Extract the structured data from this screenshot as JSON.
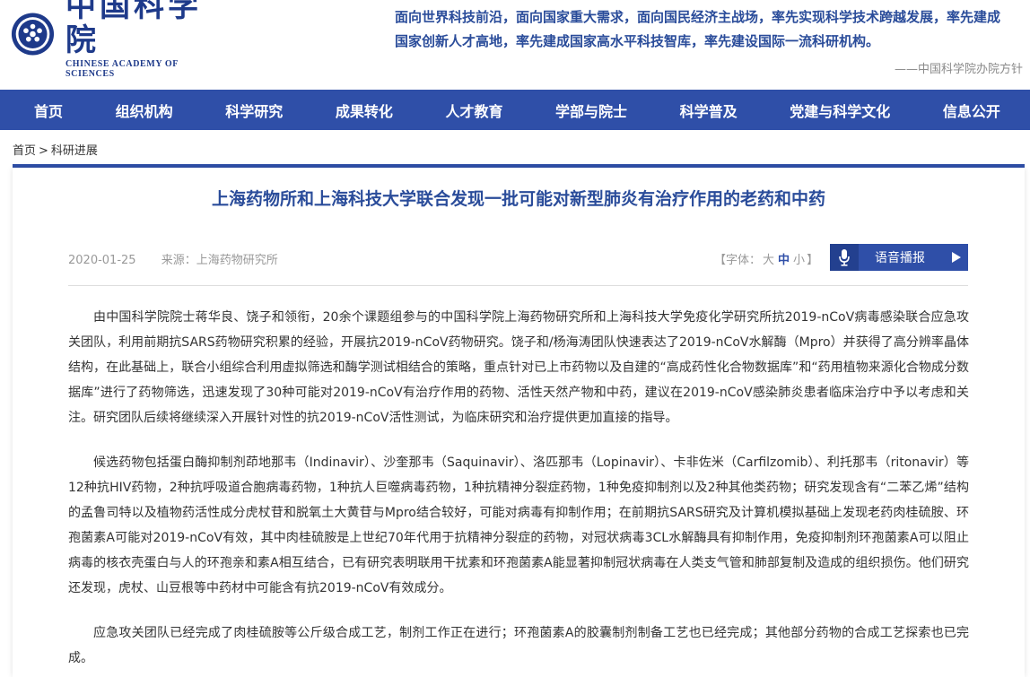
{
  "header": {
    "logo_cn": "中国科学院",
    "logo_en": "CHINESE ACADEMY OF SCIENCES",
    "motto_line1": "面向世界科技前沿，面向国家重大需求，面向国民经济主战场，率先实现科学技术跨越发展，率先建成",
    "motto_line2": "国家创新人才高地，率先建成国家高水平科技智库，率先建设国际一流科研机构。",
    "motto_sign": "——中国科学院办院方针"
  },
  "nav": {
    "items": [
      "首页",
      "组织机构",
      "科学研究",
      "成果转化",
      "人才教育",
      "学部与院士",
      "科学普及",
      "党建与科学文化",
      "信息公开"
    ]
  },
  "breadcrumb": {
    "home": "首页",
    "sep": ">",
    "current": "科研进展"
  },
  "article": {
    "title": "上海药物所和上海科技大学联合发现一批可能对新型肺炎有治疗作用的老药和中药",
    "date": "2020-01-25",
    "source_label": "来源：",
    "source": "上海药物研究所",
    "font_prefix": "【字体：",
    "font_large": "大",
    "font_medium": "中",
    "font_small": "小",
    "font_suffix": "】",
    "audio_label": "语音播报",
    "paragraphs": [
      "由中国科学院院士蒋华良、饶子和领衔，20余个课题组参与的中国科学院上海药物研究所和上海科技大学免疫化学研究所抗2019-nCoV病毒感染联合应急攻关团队，利用前期抗SARS药物研究积累的经验，开展抗2019-nCoV药物研究。饶子和/杨海涛团队快速表达了2019-nCoV水解酶（Mpro）并获得了高分辨率晶体结构，在此基础上，联合小组综合利用虚拟筛选和酶学测试相结合的策略，重点针对已上市药物以及自建的“高成药性化合物数据库”和“药用植物来源化合物成分数据库”进行了药物筛选，迅速发现了30种可能对2019-nCoV有治疗作用的药物、活性天然产物和中药，建议在2019-nCoV感染肺炎患者临床治疗中予以考虑和关注。研究团队后续将继续深入开展针对性的抗2019-nCoV活性测试，为临床研究和治疗提供更加直接的指导。",
      "候选药物包括蛋白酶抑制剂茚地那韦（Indinavir）、沙奎那韦（Saquinavir）、洛匹那韦（Lopinavir）、卡非佐米（Carfilzomib）、利托那韦（ritonavir）等12种抗HIV药物，2种抗呼吸道合胞病毒药物，1种抗人巨噬病毒药物，1种抗精神分裂症药物，1种免疫抑制剂以及2种其他类药物；研究发现含有“二苯乙烯”结构的孟鲁司特以及植物药活性成分虎杖苷和脱氧土大黄苷与Mpro结合较好，可能对病毒有抑制作用；在前期抗SARS研究及计算机模拟基础上发现老药肉桂硫胺、环孢菌素A可能对2019-nCoV有效，其中肉桂硫胺是上世纪70年代用于抗精神分裂症的药物，对冠状病毒3CL水解酶具有抑制作用，免疫抑制剂环孢菌素A可以阻止病毒的核衣壳蛋白与人的环孢亲和素A相互结合，已有研究表明联用干扰素和环孢菌素A能显著抑制冠状病毒在人类支气管和肺部复制及造成的组织损伤。他们研究还发现，虎杖、山豆根等中药材中可能含有抗2019-nCoV有效成分。",
      "应急攻关团队已经完成了肉桂硫胺等公斤级合成工艺，制剂工作正在进行；环孢菌素A的胶囊制剂制备工艺也已经完成；其他部分药物的合成工艺探索也已完成。"
    ]
  },
  "colors": {
    "brand_blue": "#2f4fa8",
    "title_blue": "#2a4c9a"
  },
  "icons": {
    "emblem": "cas-emblem-icon",
    "mic": "microphone-icon",
    "play": "play-icon"
  }
}
